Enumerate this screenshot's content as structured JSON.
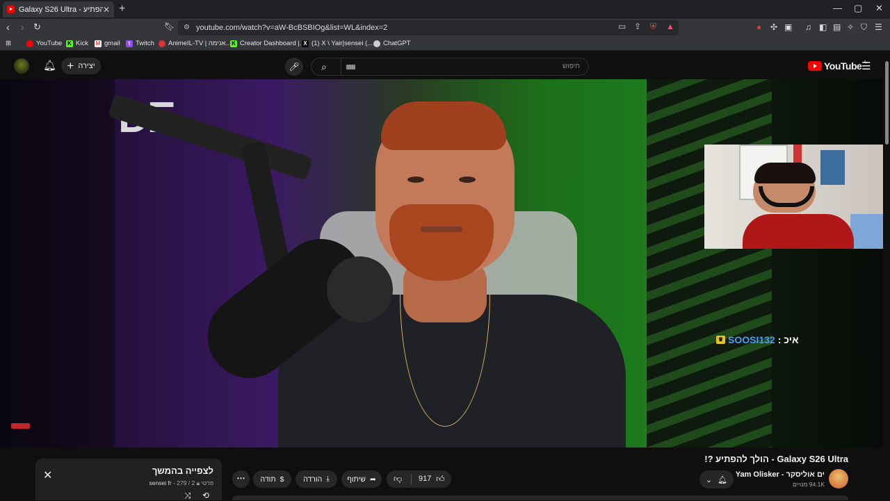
{
  "browser": {
    "tab_title": "Galaxy S26 Ultra - הולך להפתיע",
    "url": "youtube.com/watch?v=aW-BcBSBIOg&list=WL&index=2",
    "bookmarks": [
      {
        "label": "YouTube",
        "color": "#ff0000"
      },
      {
        "label": "Kick",
        "color": "#53fc18"
      },
      {
        "label": "gmail",
        "color": "#ea4335"
      },
      {
        "label": "Twitch",
        "color": "#9146ff"
      },
      {
        "label": "AnimeIL-TV | אנימה...",
        "color": "#d33"
      },
      {
        "label": "Creator Dashboard |...",
        "color": "#53fc18"
      },
      {
        "label": "(1) X \\ Yair|sensei (...",
        "color": "#ffffff"
      },
      {
        "label": "ChatGPT",
        "color": "#cccccc"
      }
    ]
  },
  "youtube": {
    "create_label": "יצירה",
    "search_placeholder": "חיפוש",
    "logo_text": "YouTube",
    "logo_sup": "IL"
  },
  "video": {
    "overlay_wall_text": "DE",
    "chat_user": "SOOSI132",
    "chat_message": "איכ :",
    "title": "Galaxy S26 Ultra - הולך להפתיע ?!",
    "channel_name": "Yam Olisker - ים אוליסקר",
    "subscribers": "94.1K מנויים",
    "likes": "917",
    "share_label": "שיתוף",
    "download_label": "הורדה",
    "thanks_label": "תודה"
  },
  "playlist": {
    "title": "לצפייה בהמשך",
    "owner": "sensei fr",
    "privacy": "פרטי",
    "position": "279 / 2"
  }
}
